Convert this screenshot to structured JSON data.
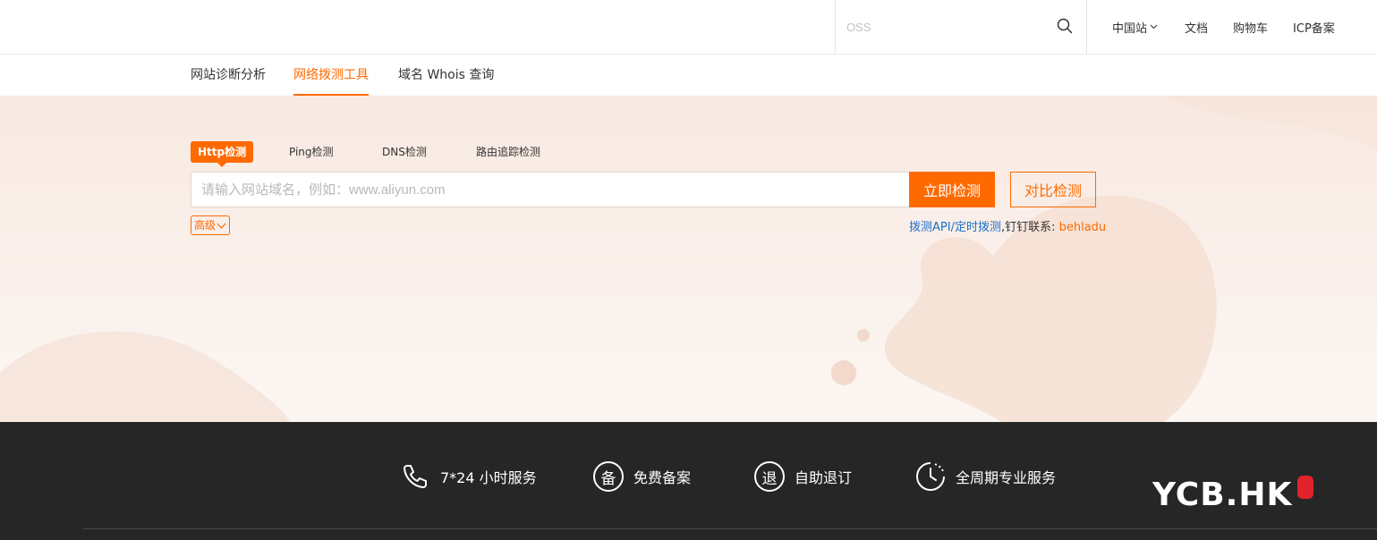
{
  "header": {
    "search_placeholder": "OSS",
    "nav": {
      "site": "中国站",
      "docs": "文档",
      "cart": "购物车",
      "icp": "ICP备案"
    }
  },
  "subnav": {
    "tabs": [
      {
        "label": "网站诊断分析",
        "active": false
      },
      {
        "label": "网络拨测工具",
        "active": true
      },
      {
        "label": "域名 Whois 查询",
        "active": false
      }
    ]
  },
  "tool": {
    "check_tabs": [
      {
        "label": "Http检测",
        "active": true
      },
      {
        "label": "Ping检测",
        "active": false
      },
      {
        "label": "DNS检测",
        "active": false
      },
      {
        "label": "路由追踪检测",
        "active": false
      }
    ],
    "input_placeholder": "请输入网站域名，例如：www.aliyun.com",
    "detect_button": "立即检测",
    "compare_button": "对比检测",
    "advanced_label": "高级",
    "api_link": "拨测API/定时拨测",
    "contact_prefix": ",钉钉联系: ",
    "contact_name": "behladu"
  },
  "footer": {
    "features": [
      {
        "icon": "phone-icon",
        "label": "7*24 小时服务"
      },
      {
        "icon": "bei-circle-icon",
        "char": "备",
        "label": "免费备案"
      },
      {
        "icon": "tui-circle-icon",
        "char": "退",
        "label": "自助退订"
      },
      {
        "icon": "clock-icon",
        "label": "全周期专业服务"
      }
    ],
    "logo_text": "YCB.HK"
  },
  "colors": {
    "accent": "#ff6a00",
    "link": "#1c6fc9",
    "footer_bg": "#262626",
    "hero_bg": "#f8e9e1"
  }
}
